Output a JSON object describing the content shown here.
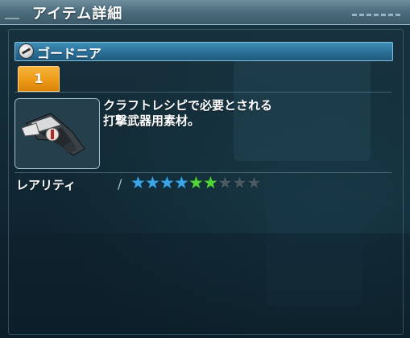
{
  "window": {
    "title": "アイテム詳細"
  },
  "item": {
    "name": "ゴードニア",
    "name_icon": "craft-material-icon",
    "tab_label": "1",
    "image_icon": "striking-weapon-material-icon",
    "description_lines": [
      "クラフトレシピで必要とされる",
      "打撃武器用素材。"
    ]
  },
  "rarity": {
    "label": "レアリティ",
    "value": 6,
    "max": 9,
    "star_colors": {
      "blue": "#3aa6e8",
      "green": "#4fd43a",
      "empty": "#4a5a62"
    }
  },
  "colors": {
    "tab_accent": "#ee9a17",
    "name_bar": "#2a6f97"
  }
}
